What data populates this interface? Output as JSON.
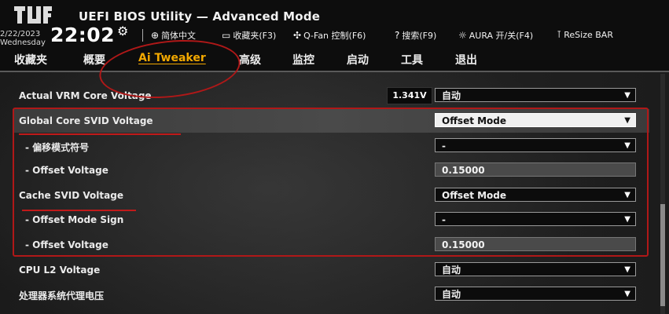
{
  "header": {
    "title": "UEFI BIOS Utility — Advanced Mode",
    "date": "2/22/2023",
    "weekday": "Wednesday",
    "time": "22:02",
    "tools": [
      {
        "icon": "globe-icon",
        "label": "简体中文"
      },
      {
        "icon": "favorites-icon",
        "label": "收藏夹(F3)"
      },
      {
        "icon": "fan-icon",
        "label": "Q-Fan 控制(F6)"
      },
      {
        "icon": "help-icon",
        "label": "搜索(F9)"
      },
      {
        "icon": "aura-icon",
        "label": "AURA 开/关(F4)"
      },
      {
        "icon": "resize-bar-icon",
        "label": "ReSize BAR"
      }
    ]
  },
  "tabs": [
    "收藏夹",
    "概要",
    "Ai Tweaker",
    "高级",
    "监控",
    "启动",
    "工具",
    "退出"
  ],
  "active_tab": "Ai Tweaker",
  "settings": [
    {
      "label": "Actual VRM Core Voltage",
      "readout": "1.341V",
      "value": "自动",
      "kind": "dropdown"
    },
    {
      "label": "Global Core SVID Voltage",
      "value": "Offset Mode",
      "kind": "dropdown",
      "highlighted": true
    },
    {
      "label": "- 偏移模式符号",
      "value": "-",
      "kind": "dropdown"
    },
    {
      "label": "- Offset Voltage",
      "value": "0.15000",
      "kind": "field"
    },
    {
      "label": "Cache SVID Voltage",
      "value": "Offset Mode",
      "kind": "dropdown"
    },
    {
      "label": "- Offset Mode Sign",
      "value": "-",
      "kind": "dropdown"
    },
    {
      "label": "- Offset Voltage",
      "value": "0.15000",
      "kind": "field"
    },
    {
      "label": "CPU L2 Voltage",
      "value": "自动",
      "kind": "dropdown"
    },
    {
      "label": "处理器系统代理电压",
      "value": "自动",
      "kind": "dropdown"
    }
  ],
  "colors": {
    "accent": "#f2a800",
    "annotation": "#b01818",
    "background": "#1b1b1b"
  }
}
